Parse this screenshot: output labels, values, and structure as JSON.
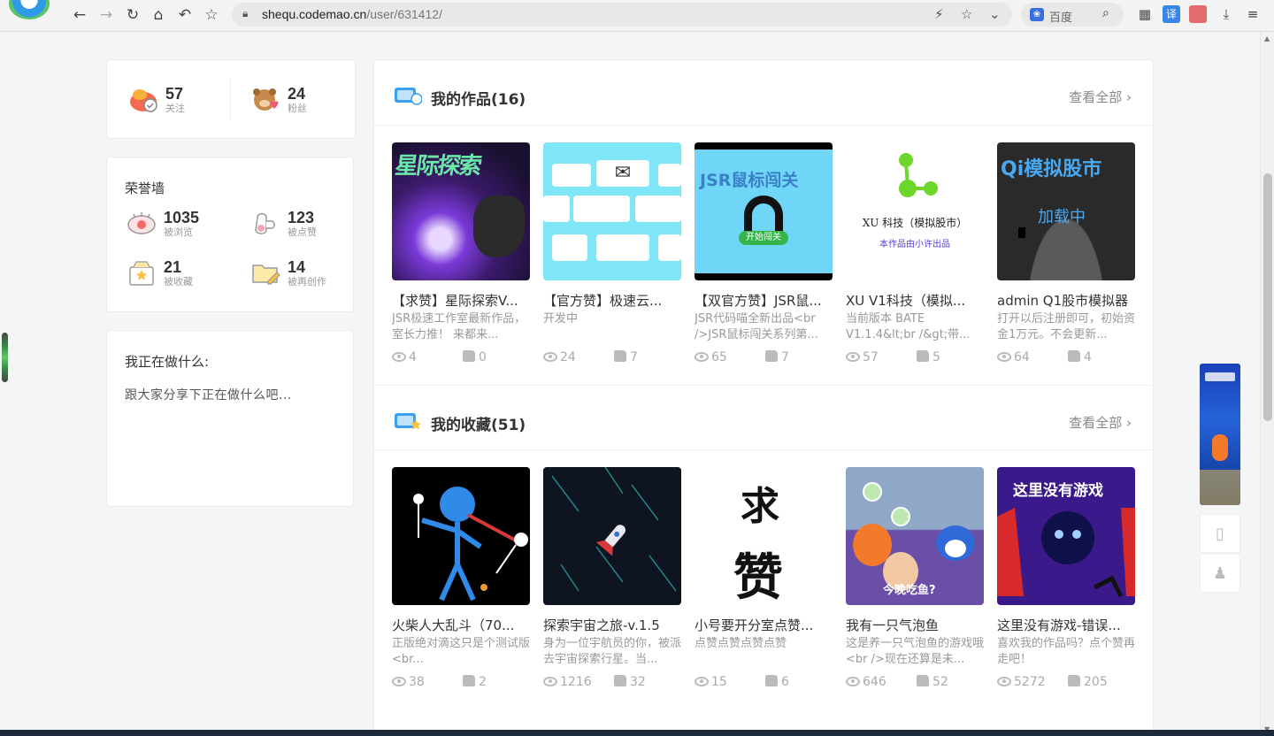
{
  "browser": {
    "url_host": "shequ.codemao.cn",
    "url_path": "/user/631412/",
    "search_engine": "百度"
  },
  "profile_stats": {
    "following": {
      "value": "57",
      "label": "关注"
    },
    "fans": {
      "value": "24",
      "label": "粉丝"
    }
  },
  "honor": {
    "title": "荣誉墙",
    "items": [
      {
        "value": "1035",
        "label": "被浏览"
      },
      {
        "value": "123",
        "label": "被点赞"
      },
      {
        "value": "21",
        "label": "被收藏"
      },
      {
        "value": "14",
        "label": "被再创作"
      }
    ]
  },
  "doing": {
    "title": "我正在做什么:",
    "text": "跟大家分享下正在做什么吧..."
  },
  "works": {
    "title": "我的作品(16)",
    "more": "查看全部",
    "items": [
      {
        "title": "【求赞】星际探索V...",
        "desc": "JSR极速工作室最新作品，室长力推！ 来都来...",
        "views": "4",
        "likes": "0"
      },
      {
        "title": "【官方赞】极速云...",
        "desc": "开发中",
        "views": "24",
        "likes": "7"
      },
      {
        "title": "【双官方赞】JSR鼠...",
        "desc": "JSR代码喵全新出品<br />JSR鼠标闯关系列第...",
        "views": "65",
        "likes": "7"
      },
      {
        "title": "XU V1科技（模拟...",
        "desc": "当前版本 BATE V1.1.4&lt;br /&gt;带...",
        "views": "57",
        "likes": "5"
      },
      {
        "title": "admin Q1股市模拟器",
        "desc": "打开以后注册即可，初始资金1万元。不会更新...",
        "views": "64",
        "likes": "4"
      }
    ]
  },
  "favorites": {
    "title": "我的收藏(51)",
    "more": "查看全部",
    "items": [
      {
        "title": "火柴人大乱斗（70...",
        "desc": "正版绝对滴这只是个测试版<br...",
        "views": "38",
        "likes": "2"
      },
      {
        "title": "探索宇宙之旅-v.1.5",
        "desc": "身为一位宇航员的你，被派去宇宙探索行星。当...",
        "views": "1216",
        "likes": "32"
      },
      {
        "title": "小号要开分室点赞...",
        "desc": "点赞点赞点赞点赞",
        "views": "15",
        "likes": "6"
      },
      {
        "title": "我有一只气泡鱼",
        "desc": "这是养一只气泡鱼的游戏哦<br />现在还算是未...",
        "views": "646",
        "likes": "52"
      },
      {
        "title": "这里没有游戏-错误...",
        "desc": "喜欢我的作品吗？点个赞再走吧！",
        "views": "5272",
        "likes": "205"
      }
    ]
  },
  "thumb_text": {
    "w1": "星际探索",
    "w3": "JSR鼠标闯关",
    "w3b": "开始闯关",
    "w4a": "XU 科技（模拟股市）",
    "w4b": "本作品由小许出品",
    "w5a": "Qi模拟股市",
    "w5b": "加载中",
    "f3a": "求",
    "f3b": "赞",
    "f4": "今晚吃鱼?",
    "f5": "这里没有游戏"
  },
  "colors": {
    "accent": "#2f9be8",
    "text": "#333333",
    "muted": "#999999"
  }
}
